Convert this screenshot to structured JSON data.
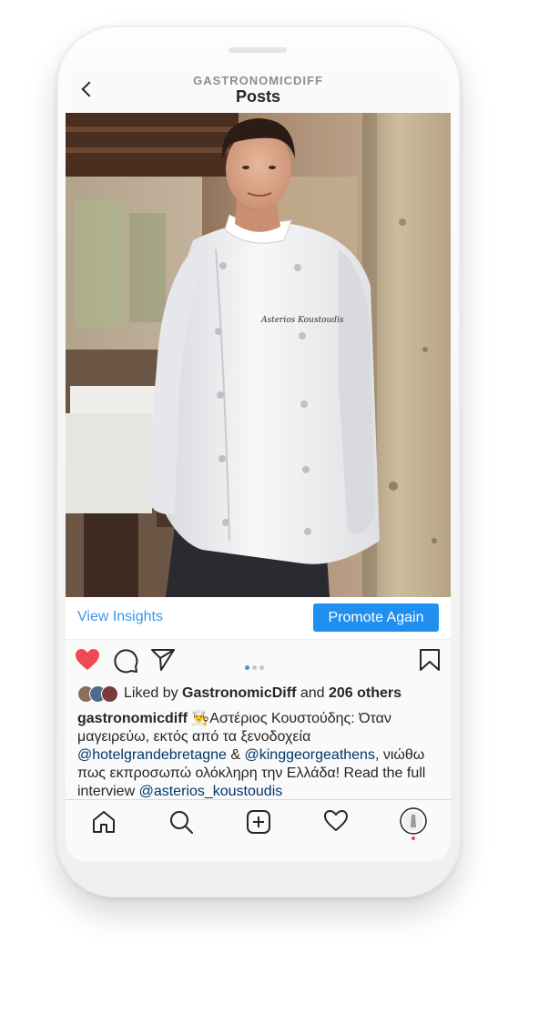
{
  "header": {
    "account": "GASTRONOMICDIFF",
    "title": "Posts"
  },
  "post_image": {
    "subject": "chef in white jacket leaning on stone wall in restaurant",
    "jacket_embroidery": "Asterios Koustoudis"
  },
  "insights_bar": {
    "view_insights_label": "View Insights",
    "promote_label": "Promote Again",
    "accent_color": "#3897f0"
  },
  "actions": {
    "like_icon": "heart-filled-icon",
    "comment_icon": "comment-icon",
    "share_icon": "paper-plane-icon",
    "save_icon": "bookmark-icon",
    "carousel_slides": 3,
    "carousel_active": 1,
    "like_color": "#ed4956"
  },
  "likes": {
    "prefix": "Liked by",
    "user": "GastronomicDiff",
    "and": "and",
    "others": "206 others"
  },
  "caption": {
    "username": "gastronomicdiff",
    "emoji": "👨‍🍳",
    "text_1": "Αστέριος Κουστούδης: Όταν μαγειρεύω, εκτός από τα ξενοδοχεία",
    "mention_1": "@hotelgrandebretagne",
    "amp": "&",
    "mention_2": "@kinggeorgeathens",
    "text_2": ", νιώθω πως εκπροσωπώ ολόκληρη την Ελλάδα! Read the full interview",
    "mention_3": "@asterios_koustoudis"
  },
  "bottom_nav": {
    "items": [
      "home-icon",
      "search-icon",
      "new-post-icon",
      "activity-heart-icon",
      "profile-avatar"
    ],
    "notification_color": "#ed4956"
  }
}
